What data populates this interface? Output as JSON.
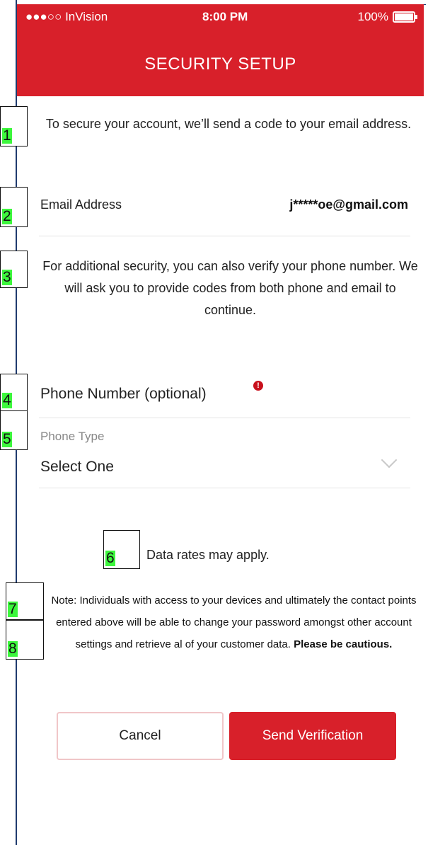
{
  "status_bar": {
    "carrier": "●●●○○ InVision",
    "time": "8:00 PM",
    "battery": "100%"
  },
  "header": {
    "title": "SECURITY SETUP"
  },
  "intro": {
    "text": "To secure your account, we’ll send a code to your email address."
  },
  "email": {
    "label": "Email Address",
    "value": "j*****oe@gmail.com"
  },
  "additional": {
    "text": "For additional security, you can also verify your phone number. We will ask you to provide codes from both phone and email to continue."
  },
  "phone": {
    "label": "Phone Number (optional)",
    "info_icon": "!"
  },
  "phone_type": {
    "label": "Phone Type",
    "value": "Select One"
  },
  "rates": {
    "text": "Data rates may apply."
  },
  "note": {
    "text": "Note: Individuals with access to your devices and ultimately the contact points entered above will be able to change your password amongst other account settings and retrieve al of your customer data.",
    "emphasis": "Please be cautious."
  },
  "buttons": {
    "cancel": "Cancel",
    "send": "Send Verification"
  },
  "annotations": [
    "1",
    "2",
    "3",
    "4",
    "5",
    "6",
    "7",
    "8"
  ],
  "colors": {
    "brand_red": "#d8202a",
    "annotation_green": "#3df73d"
  }
}
